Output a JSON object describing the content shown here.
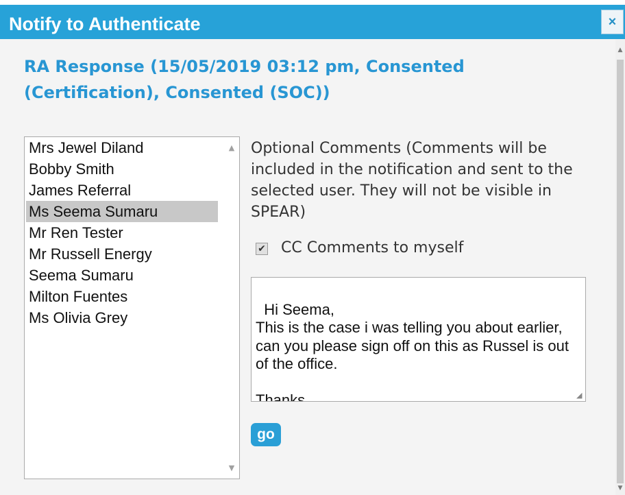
{
  "dialog": {
    "title": "Notify to Authenticate",
    "close_icon": "×"
  },
  "response_heading": "RA Response (15/05/2019 03:12 pm, Consented (Certification), Consented (SOC))",
  "user_list": {
    "items": [
      "Mrs Jewel Diland",
      "Bobby Smith",
      "James Referral",
      "Ms Seema Sumaru",
      "Mr Ren Tester",
      "Mr Russell Energy",
      "Seema Sumaru",
      "Milton Fuentes",
      "Ms Olivia Grey"
    ],
    "selected": "Ms Seema Sumaru"
  },
  "comments": {
    "label": "Optional Comments (Comments will be included in the notification and sent to the selected user. They will not be visible in SPEAR)",
    "cc_label": "CC Comments to myself",
    "cc_checked": true,
    "value": "Hi Seema,\nThis is the case i was telling you about earlier, can you please sign off on this as Russel is out of the office.\n\nThanks"
  },
  "go_button": "go",
  "colors": {
    "title_bar": "#27a2d8",
    "heading": "#2896d3",
    "button": "#2a9fd6"
  }
}
